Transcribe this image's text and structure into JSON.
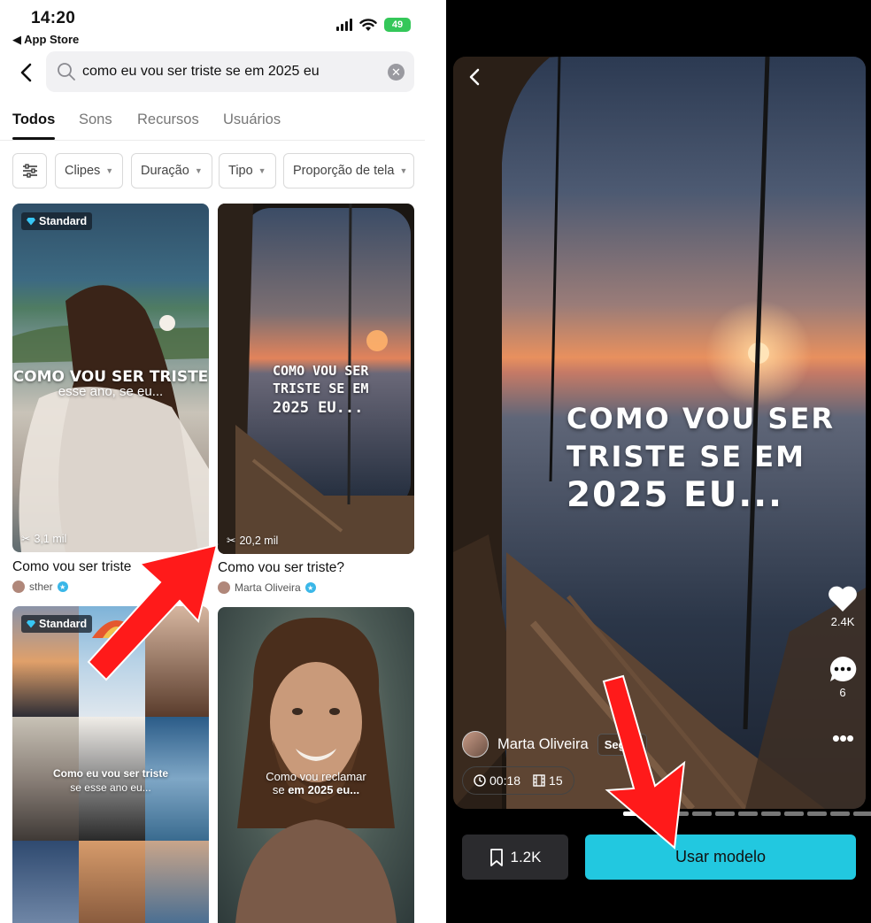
{
  "status_bar": {
    "time": "14:20",
    "back_app": "◀ App Store",
    "battery": "49"
  },
  "search": {
    "query": "como eu vou ser triste se em 2025 eu"
  },
  "tabs": [
    {
      "label": "Todos",
      "active": true
    },
    {
      "label": "Sons",
      "active": false
    },
    {
      "label": "Recursos",
      "active": false
    },
    {
      "label": "Usuários",
      "active": false
    }
  ],
  "filters": [
    {
      "label": "Clipes"
    },
    {
      "label": "Duração"
    },
    {
      "label": "Tipo"
    },
    {
      "label": "Proporção de tela"
    }
  ],
  "results": [
    {
      "badge": "Standard",
      "overlay_line1": "COMO VOU SER TRISTE",
      "overlay_line2": "esse ano, se eu...",
      "uses": "3,1 mil",
      "title": "Como vou ser triste",
      "author": "sther"
    },
    {
      "badge": "",
      "overlay_line1": "COMO VOU SER",
      "overlay_line2": "TRISTE SE EM",
      "overlay_line3": "2025 EU...",
      "uses": "20,2 mil",
      "title": "Como vou ser triste?",
      "author": "Marta Oliveira"
    },
    {
      "badge": "Standard",
      "overlay_line1": "Como eu vou ser triste",
      "overlay_line2": "se esse ano eu..."
    },
    {
      "badge": "",
      "overlay_line1": "Como vou reclamar",
      "overlay_line2": "se ",
      "overlay_line2_bold": "em 2025 eu..."
    }
  ],
  "preview": {
    "text_line1": "COMO VOU SER",
    "text_line2": "TRISTE SE EM",
    "text_line3": "2025 EU...",
    "likes": "2.4K",
    "comments": "6",
    "author": "Marta Oliveira",
    "follow": "Seguir",
    "duration": "00:18",
    "clips": "15",
    "saves": "1.2K",
    "use_label": "Usar modelo"
  },
  "colors": {
    "accent": "#22c8e0",
    "arrow": "#ff1a1a",
    "verified": "#3ab7e8"
  }
}
